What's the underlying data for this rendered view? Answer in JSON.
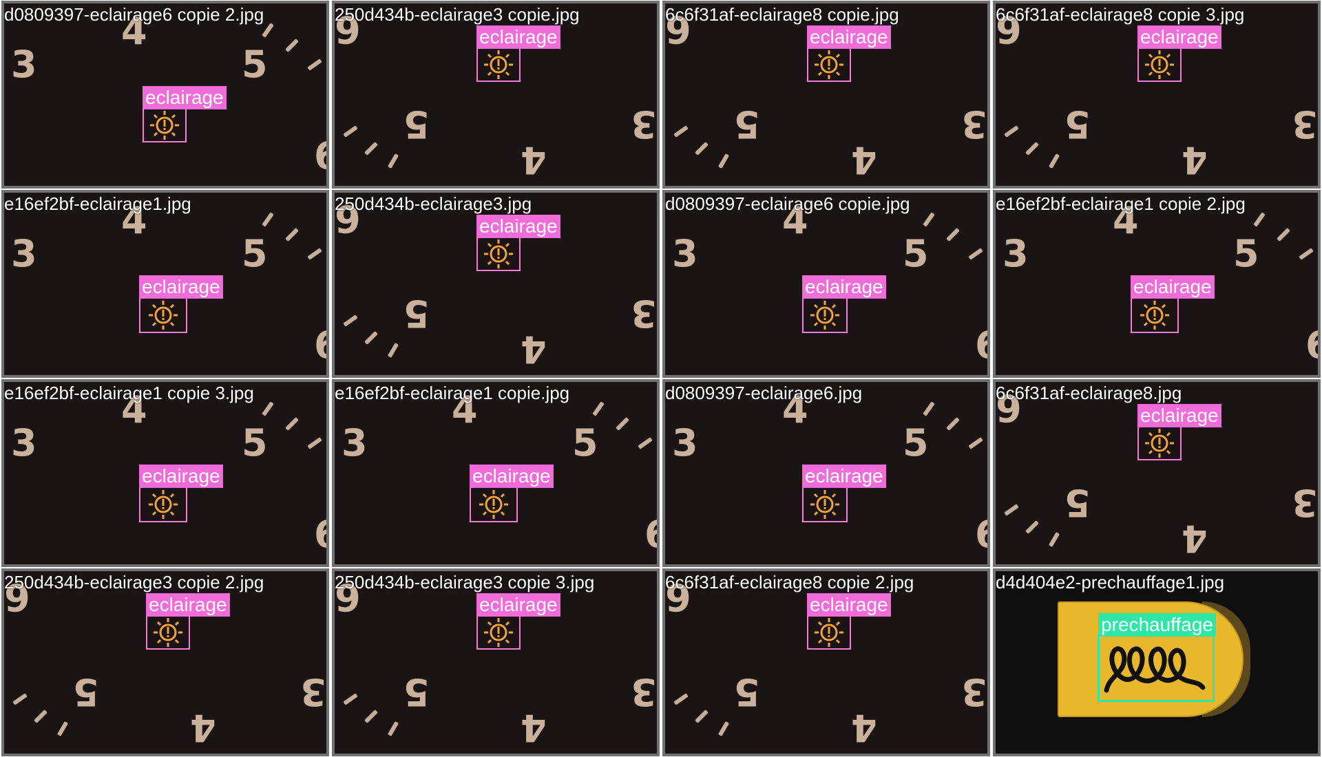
{
  "tiles": [
    {
      "filename": "d0809397-eclairage6 copie 2.jpg",
      "label": "eclairage"
    },
    {
      "filename": "250d434b-eclairage3 copie.jpg",
      "label": "eclairage"
    },
    {
      "filename": "6c6f31af-eclairage8 copie.jpg",
      "label": "eclairage"
    },
    {
      "filename": "6c6f31af-eclairage8 copie 3.jpg",
      "label": "eclairage"
    },
    {
      "filename": "e16ef2bf-eclairage1.jpg",
      "label": "eclairage"
    },
    {
      "filename": "250d434b-eclairage3.jpg",
      "label": "eclairage"
    },
    {
      "filename": "d0809397-eclairage6 copie.jpg",
      "label": "eclairage"
    },
    {
      "filename": "e16ef2bf-eclairage1 copie 2.jpg",
      "label": "eclairage"
    },
    {
      "filename": "e16ef2bf-eclairage1 copie 3.jpg",
      "label": "eclairage"
    },
    {
      "filename": "e16ef2bf-eclairage1 copie.jpg",
      "label": "eclairage"
    },
    {
      "filename": "d0809397-eclairage6.jpg",
      "label": "eclairage"
    },
    {
      "filename": "6c6f31af-eclairage8.jpg",
      "label": "eclairage"
    },
    {
      "filename": "250d434b-eclairage3 copie 2.jpg",
      "label": "eclairage"
    },
    {
      "filename": "250d434b-eclairage3 copie 3.jpg",
      "label": "eclairage"
    },
    {
      "filename": "6c6f31af-eclairage8 copie 2.jpg",
      "label": "eclairage"
    },
    {
      "filename": "d4d404e2-prechauffage1.jpg",
      "label": "prechauffage"
    }
  ],
  "gauge_numbers": {
    "a": "3",
    "b": "4",
    "c": "5",
    "d": "6"
  },
  "colors": {
    "eclairage": "#f06cd8",
    "prechauffage": "#2ee6a7",
    "panel": "#e9b72b"
  },
  "icons": {
    "eclairage": "light-warning-icon",
    "prechauffage": "glow-plug-icon"
  }
}
